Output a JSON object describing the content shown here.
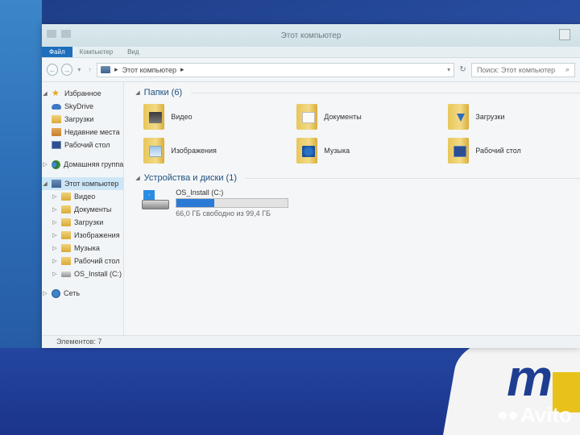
{
  "window": {
    "title": "Этот компьютер"
  },
  "ribbon": {
    "tabs": [
      "Файл",
      "Компьютер",
      "Вид"
    ]
  },
  "address": {
    "path": "Этот компьютер",
    "search_placeholder": "Поиск: Этот компьютер"
  },
  "nav": {
    "favorites": "Избранное",
    "skydrive": "SkyDrive",
    "downloads": "Загрузки",
    "recent": "Недавние места",
    "desktop": "Рабочий стол",
    "homegroup": "Домашняя группа",
    "this_pc": "Этот компьютер",
    "pc_items": [
      "Видео",
      "Документы",
      "Загрузки",
      "Изображения",
      "Музыка",
      "Рабочий стол",
      "OS_Install (C:)"
    ],
    "network": "Сеть"
  },
  "content": {
    "folders_header": "Папки (6)",
    "folders": [
      "Видео",
      "Документы",
      "Загрузки",
      "Изображения",
      "Музыка",
      "Рабочий стол"
    ],
    "devices_header": "Устройства и диски (1)",
    "drive": {
      "name": "OS_Install (C:)",
      "free_text": "66,0 ГБ свободно из 99,4 ГБ",
      "used_fraction": 0.336
    }
  },
  "status": {
    "items": "Элементов: 7"
  },
  "desktop": {
    "watermark": "Avito",
    "brand_glyph": "m"
  },
  "colors": {
    "accent": "#1d6ebd",
    "progress": "#2b7ad6"
  }
}
